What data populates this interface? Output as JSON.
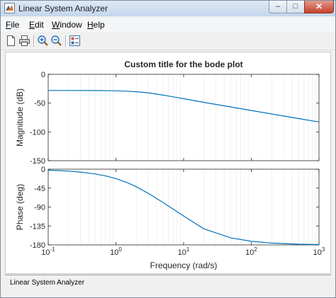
{
  "window": {
    "title": "Linear System Analyzer"
  },
  "menu": {
    "file": "File",
    "edit": "Edit",
    "window": "Window",
    "help": "Help"
  },
  "toolbar": {
    "icons": [
      "new-figure-icon",
      "print-icon",
      "zoom-in-icon",
      "zoom-out-icon",
      "plot-configurations-icon"
    ]
  },
  "status": {
    "text": "Linear System Analyzer"
  },
  "colors": {
    "curve": "#0072bd",
    "axes": "#262626",
    "grid": "#e6e6e6",
    "close_button": "#c5432b"
  },
  "chart_data": {
    "type": "line",
    "title": "Custom title for the bode plot",
    "xlabel": "Frequency  (rad/s)",
    "x_scale": "log",
    "xlim": [
      0.1,
      1000
    ],
    "x_ticks": [
      0.1,
      1,
      10,
      100,
      1000
    ],
    "x_tick_labels": [
      {
        "base": "10",
        "exp": "-1"
      },
      {
        "base": "10",
        "exp": "0"
      },
      {
        "base": "10",
        "exp": "1"
      },
      {
        "base": "10",
        "exp": "2"
      },
      {
        "base": "10",
        "exp": "3"
      }
    ],
    "subplots": [
      {
        "ylabel": "Magnitude (dB)",
        "ylim": [
          -150,
          0
        ],
        "y_ticks": [
          0,
          -50,
          -100,
          -150
        ],
        "y_tick_labels": [
          "0",
          "-50",
          "-100",
          "-150"
        ],
        "series": [
          {
            "x": [
              0.1,
              0.2,
              0.5,
              1,
              1.5,
              2,
              3,
              5,
              7,
              10,
              15,
              20,
              30,
              50,
              100,
              200,
              500,
              1000
            ],
            "values": [
              -28,
              -28,
              -28.1,
              -28.6,
              -29.3,
              -30.2,
              -32.1,
              -36.1,
              -39.1,
              -42.3,
              -46.1,
              -48.7,
              -52.3,
              -56.7,
              -62.8,
              -68.9,
              -76.8,
              -82.8
            ]
          }
        ]
      },
      {
        "ylabel": "Phase (deg)",
        "ylim": [
          -180,
          0
        ],
        "y_ticks": [
          0,
          -45,
          -90,
          -135,
          -180
        ],
        "y_tick_labels": [
          "0",
          "-45",
          "-90",
          "-135",
          "-180"
        ],
        "series": [
          {
            "x": [
              0.1,
              0.2,
              0.3,
              0.5,
              0.7,
              1,
              1.5,
              2,
              3,
              5,
              7,
              10,
              20,
              50,
              100,
              200,
              500,
              1000
            ],
            "values": [
              -2.3,
              -4.6,
              -6.9,
              -11.4,
              -15.8,
              -22.3,
              -32.5,
              -41.8,
              -57.2,
              -79.4,
              -94.9,
              -111.2,
              -141.8,
              -163.4,
              -171.4,
              -175.7,
              -178.3,
              -179.1
            ]
          }
        ]
      }
    ]
  }
}
